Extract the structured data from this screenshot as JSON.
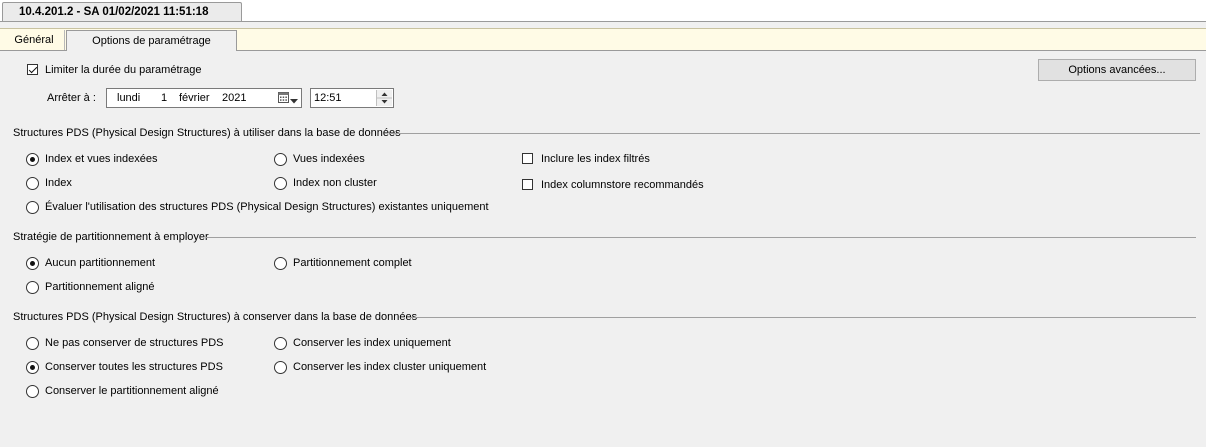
{
  "document_tab": {
    "title": "10.4.201.2 - SA 01/02/2021 11:51:18"
  },
  "tabs": [
    {
      "label": "Général"
    },
    {
      "label": "Options de paramétrage"
    }
  ],
  "tuning": {
    "limit_label": "Limiter la durée du paramétrage",
    "limit_checked": true,
    "advanced_button": "Options avancées...",
    "stop_label": "Arrêter à :",
    "date": {
      "day_name": "lundi",
      "day": "1",
      "month": "février",
      "year": "2021"
    },
    "time": "12:51"
  },
  "pds_use": {
    "title": "Structures PDS (Physical Design Structures) à utiliser dans la base de données",
    "options": [
      {
        "label": "Index et vues indexées",
        "checked": true
      },
      {
        "label": "Vues indexées",
        "checked": false
      },
      {
        "label": "Index",
        "checked": false
      },
      {
        "label": "Index non cluster",
        "checked": false
      },
      {
        "label": "Évaluer l'utilisation des structures PDS (Physical Design Structures) existantes uniquement",
        "checked": false
      }
    ],
    "checkboxes": [
      {
        "label": "Inclure les index filtrés",
        "checked": false
      },
      {
        "label": "Index columnstore recommandés",
        "checked": false
      }
    ]
  },
  "partitioning": {
    "title": "Stratégie de partitionnement à employer",
    "options": [
      {
        "label": "Aucun partitionnement",
        "checked": true
      },
      {
        "label": "Partitionnement complet",
        "checked": false
      },
      {
        "label": "Partitionnement aligné",
        "checked": false
      }
    ]
  },
  "pds_keep": {
    "title": "Structures PDS (Physical Design Structures) à conserver dans la base de données",
    "options": [
      {
        "label": "Ne pas conserver de structures PDS",
        "checked": false
      },
      {
        "label": "Conserver les index uniquement",
        "checked": false
      },
      {
        "label": "Conserver toutes les structures PDS",
        "checked": true
      },
      {
        "label": "Conserver les index cluster uniquement",
        "checked": false
      },
      {
        "label": "Conserver le partitionnement aligné",
        "checked": false
      }
    ]
  }
}
